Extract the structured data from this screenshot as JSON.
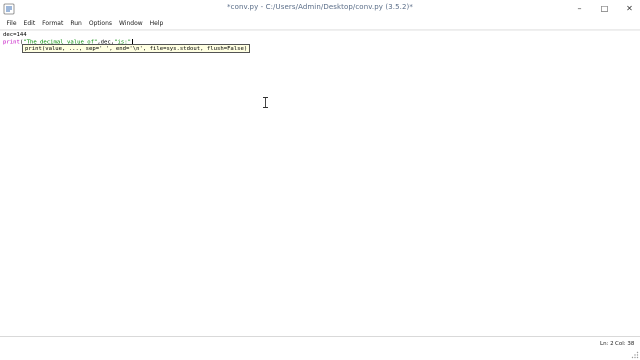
{
  "window": {
    "title": "*conv.py - C:/Users/Admin/Desktop/conv.py (3.5.2)*",
    "controls": {
      "minimize": "–",
      "maximize": "□",
      "close": "✕"
    }
  },
  "menu": [
    "File",
    "Edit",
    "Format",
    "Run",
    "Options",
    "Window",
    "Help"
  ],
  "editor": {
    "line1": "dec=144",
    "line2": {
      "keyword": "print",
      "open": "(",
      "string1": "\"The decimal value of\"",
      "mid": ",dec,",
      "string2": "\"is:\""
    },
    "calltip": "print(value, ..., sep=' ', end='\\n', file=sys.stdout, flush=False)"
  },
  "status": {
    "ln": "Ln: 2",
    "col": "Col: 38"
  },
  "colors": {
    "keyword": "#c000c0",
    "string": "#008a00",
    "calltip_bg": "#ffffe2"
  }
}
